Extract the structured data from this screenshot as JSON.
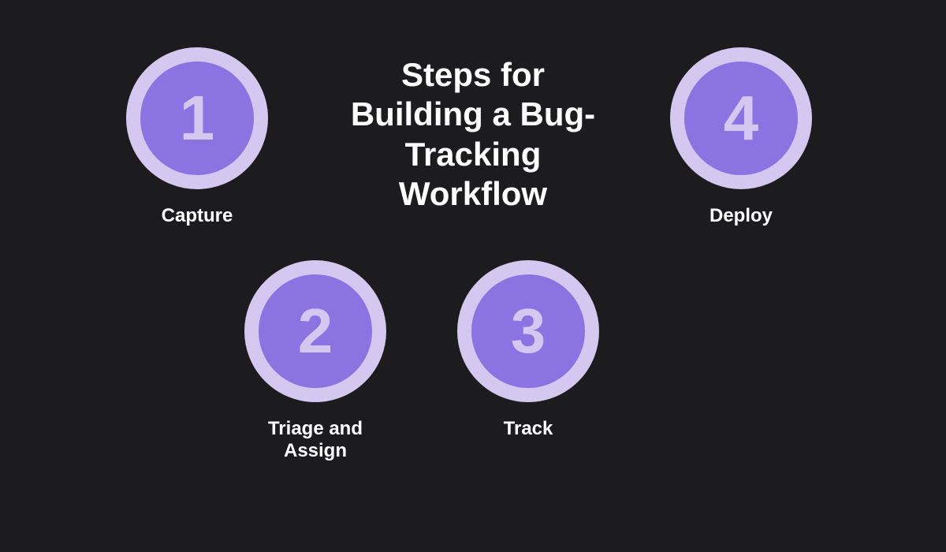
{
  "title": "Steps for Building a Bug-Tracking Workflow",
  "steps": [
    {
      "number": "1",
      "label": "Capture"
    },
    {
      "number": "2",
      "label": "Triage and Assign"
    },
    {
      "number": "3",
      "label": "Track"
    },
    {
      "number": "4",
      "label": "Deploy"
    }
  ],
  "colors": {
    "background": "#1c1c1e",
    "circleFill": "#8b73e1",
    "circleBorder": "#d4c7f0",
    "text": "#ffffff"
  }
}
